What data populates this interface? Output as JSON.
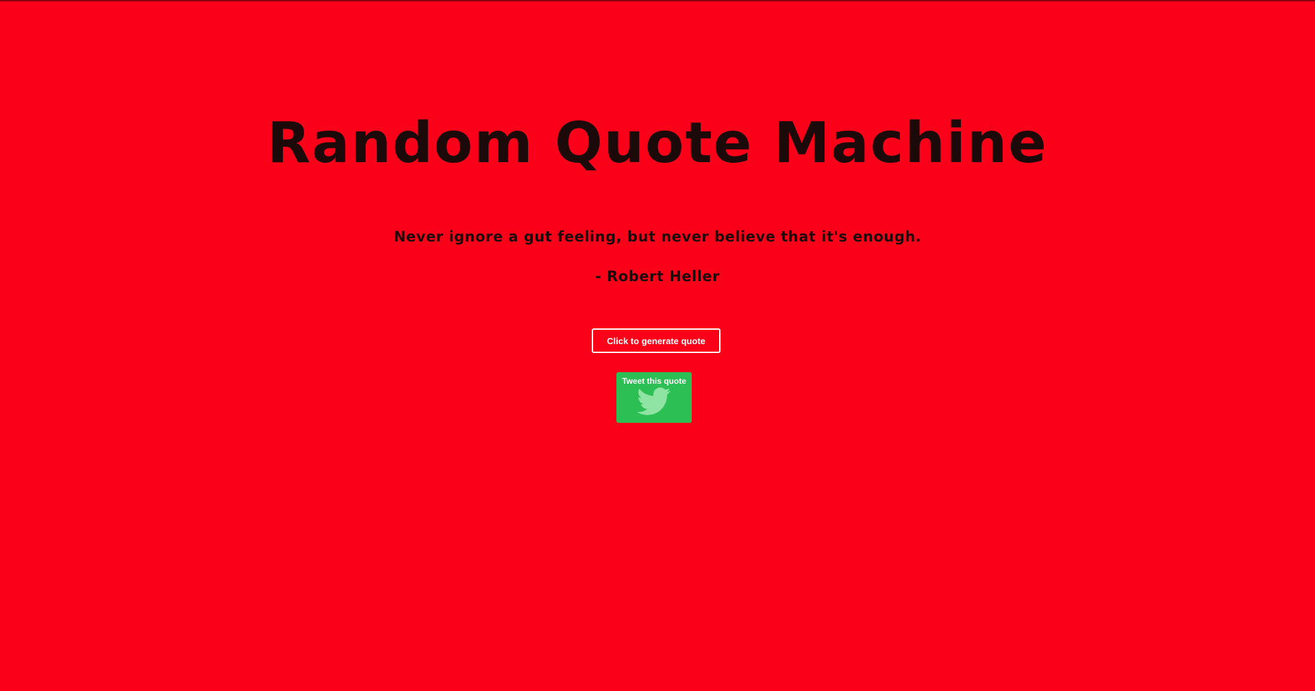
{
  "page": {
    "title": "Random Quote Machine"
  },
  "quote": {
    "text": "Never ignore a gut feeling, but never believe that it's enough.",
    "author": "- Robert Heller"
  },
  "actions": {
    "generate_label": "Click to generate quote",
    "tweet_label": "Tweet this quote",
    "tweet_icon": "twitter-bird-icon"
  },
  "colors": {
    "background": "#fb0019",
    "text": "#1c0a0a",
    "tweet_button": "#2cbf54",
    "twitter_icon": "#8fe3a3",
    "button_border": "#ffffff"
  }
}
